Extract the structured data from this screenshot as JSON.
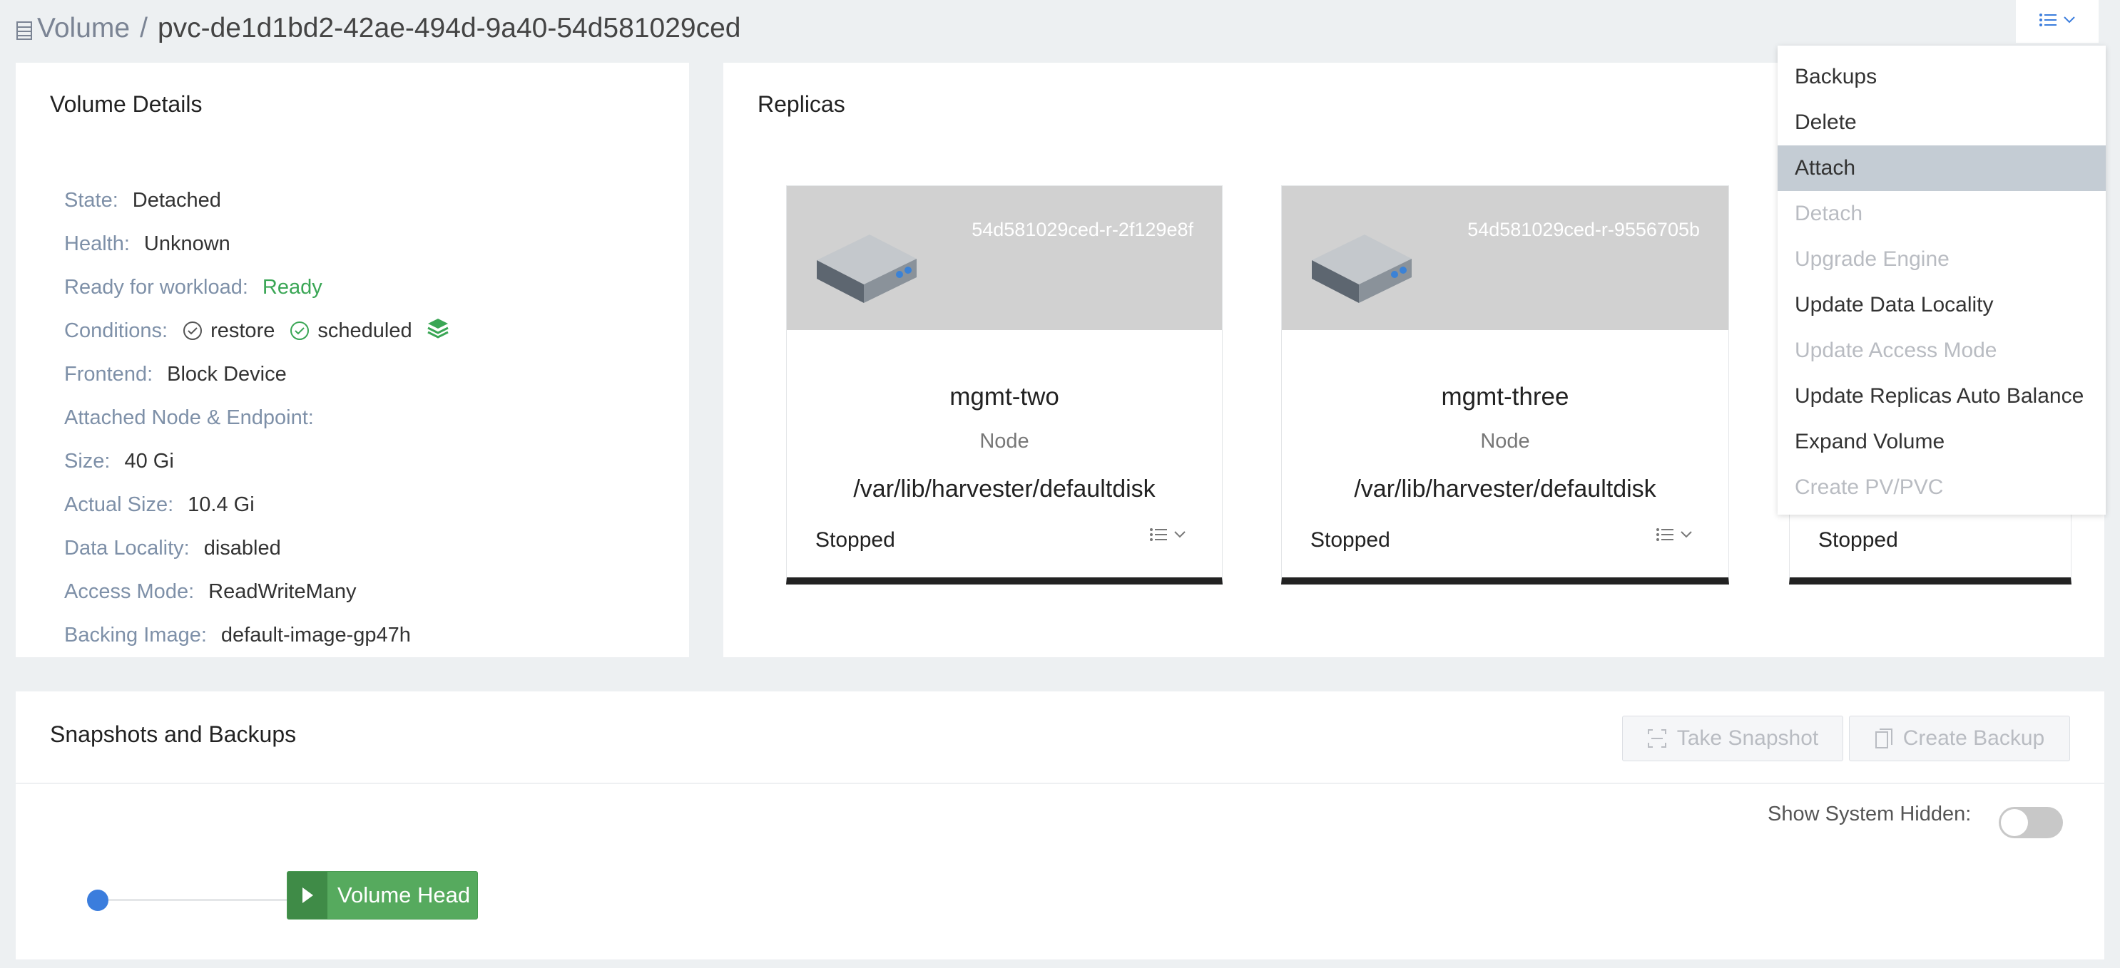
{
  "breadcrumb": {
    "parent": "Volume",
    "separator": "/",
    "current": "pvc-de1d1bd2-42ae-494d-9a40-54d581029ced"
  },
  "details": {
    "title": "Volume Details",
    "state": {
      "label": "State:",
      "value": "Detached"
    },
    "health": {
      "label": "Health:",
      "value": "Unknown"
    },
    "ready": {
      "label": "Ready for workload:",
      "value": "Ready"
    },
    "conditions": {
      "label": "Conditions:",
      "items": [
        "restore",
        "scheduled"
      ]
    },
    "frontend": {
      "label": "Frontend:",
      "value": "Block Device"
    },
    "attached": {
      "label": "Attached Node & Endpoint:"
    },
    "size": {
      "label": "Size:",
      "value": "40 Gi"
    },
    "actual_size": {
      "label": "Actual Size:",
      "value": "10.4 Gi"
    },
    "data_locality": {
      "label": "Data Locality:",
      "value": "disabled"
    },
    "access_mode": {
      "label": "Access Mode:",
      "value": "ReadWriteMany"
    },
    "backing_image": {
      "label": "Backing Image:",
      "value": "default-image-gp47h"
    }
  },
  "replicas": {
    "title": "Replicas",
    "cards": [
      {
        "id": "54d581029ced-r-2f129e8f",
        "node": "mgmt-two",
        "type": "Node",
        "path": "/var/lib/harvester/defaultdisk",
        "status": "Stopped"
      },
      {
        "id": "54d581029ced-r-9556705b",
        "node": "mgmt-three",
        "type": "Node",
        "path": "/var/lib/harvester/defaultdisk",
        "status": "Stopped"
      },
      {
        "status": "Stopped"
      }
    ]
  },
  "actions_menu": {
    "items": [
      {
        "label": "Backups",
        "state": "enabled"
      },
      {
        "label": "Delete",
        "state": "enabled"
      },
      {
        "label": "Attach",
        "state": "highlighted"
      },
      {
        "label": "Detach",
        "state": "disabled"
      },
      {
        "label": "Upgrade Engine",
        "state": "disabled"
      },
      {
        "label": "Update Data Locality",
        "state": "enabled"
      },
      {
        "label": "Update Access Mode",
        "state": "disabled"
      },
      {
        "label": "Update Replicas Auto Balance",
        "state": "enabled"
      },
      {
        "label": "Expand Volume",
        "state": "enabled"
      },
      {
        "label": "Create PV/PVC",
        "state": "disabled"
      }
    ]
  },
  "snapshots": {
    "title": "Snapshots and Backups",
    "take_snapshot": "Take Snapshot",
    "create_backup": "Create Backup",
    "show_hidden_label": "Show System Hidden:",
    "show_hidden_on": false,
    "volume_head": "Volume Head"
  },
  "colors": {
    "ready": "#3aa655",
    "accent": "#3b7ddd",
    "volume_head": "#56aa5e",
    "menu_highlight": "#c4ccd4"
  },
  "icons": [
    "volume-icon",
    "list-menu-icon",
    "chevron-down-icon",
    "check-circle-icon",
    "layers-icon",
    "disk-icon",
    "snapshot-icon",
    "backup-icon",
    "play-icon"
  ]
}
